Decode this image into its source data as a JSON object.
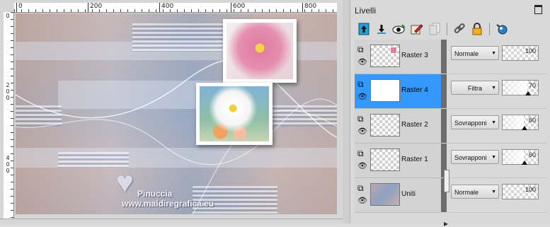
{
  "ruler": {
    "h_labels": [
      "0",
      "200",
      "400",
      "600",
      "800"
    ],
    "v_labels": [
      [
        "0"
      ],
      [
        "2",
        "0",
        "0"
      ],
      [
        "4",
        "0",
        "0"
      ]
    ]
  },
  "watermark": {
    "name": "Pinuccia",
    "site": "www.maidiregrafica.eu"
  },
  "panel": {
    "title": "Livelli",
    "toolbar_icons": [
      "move-layer-up-icon",
      "move-layer-down-icon",
      "visibility-toggle-icon",
      "edit-icon",
      "duplicate-icon",
      "link-icon",
      "lock-icon",
      "mask-icon"
    ]
  },
  "layers": [
    {
      "name": "Raster 3",
      "blend": "Normale",
      "opacity": 100,
      "selected": false,
      "thumb": "raster"
    },
    {
      "name": "Raster 4",
      "blend": "Filtra",
      "opacity": 70,
      "selected": true,
      "thumb": "blank"
    },
    {
      "name": "Raster 2",
      "blend": "Sovrapponi",
      "opacity": 60,
      "selected": false,
      "thumb": "raster"
    },
    {
      "name": "Raster 1",
      "blend": "Sovrapponi",
      "opacity": 60,
      "selected": false,
      "thumb": "raster"
    },
    {
      "name": "Uniti",
      "blend": "Normale",
      "opacity": 100,
      "selected": false,
      "thumb": "merged"
    }
  ],
  "colors": {
    "selection": "#3399ff",
    "divider": "#6c6c6c"
  }
}
